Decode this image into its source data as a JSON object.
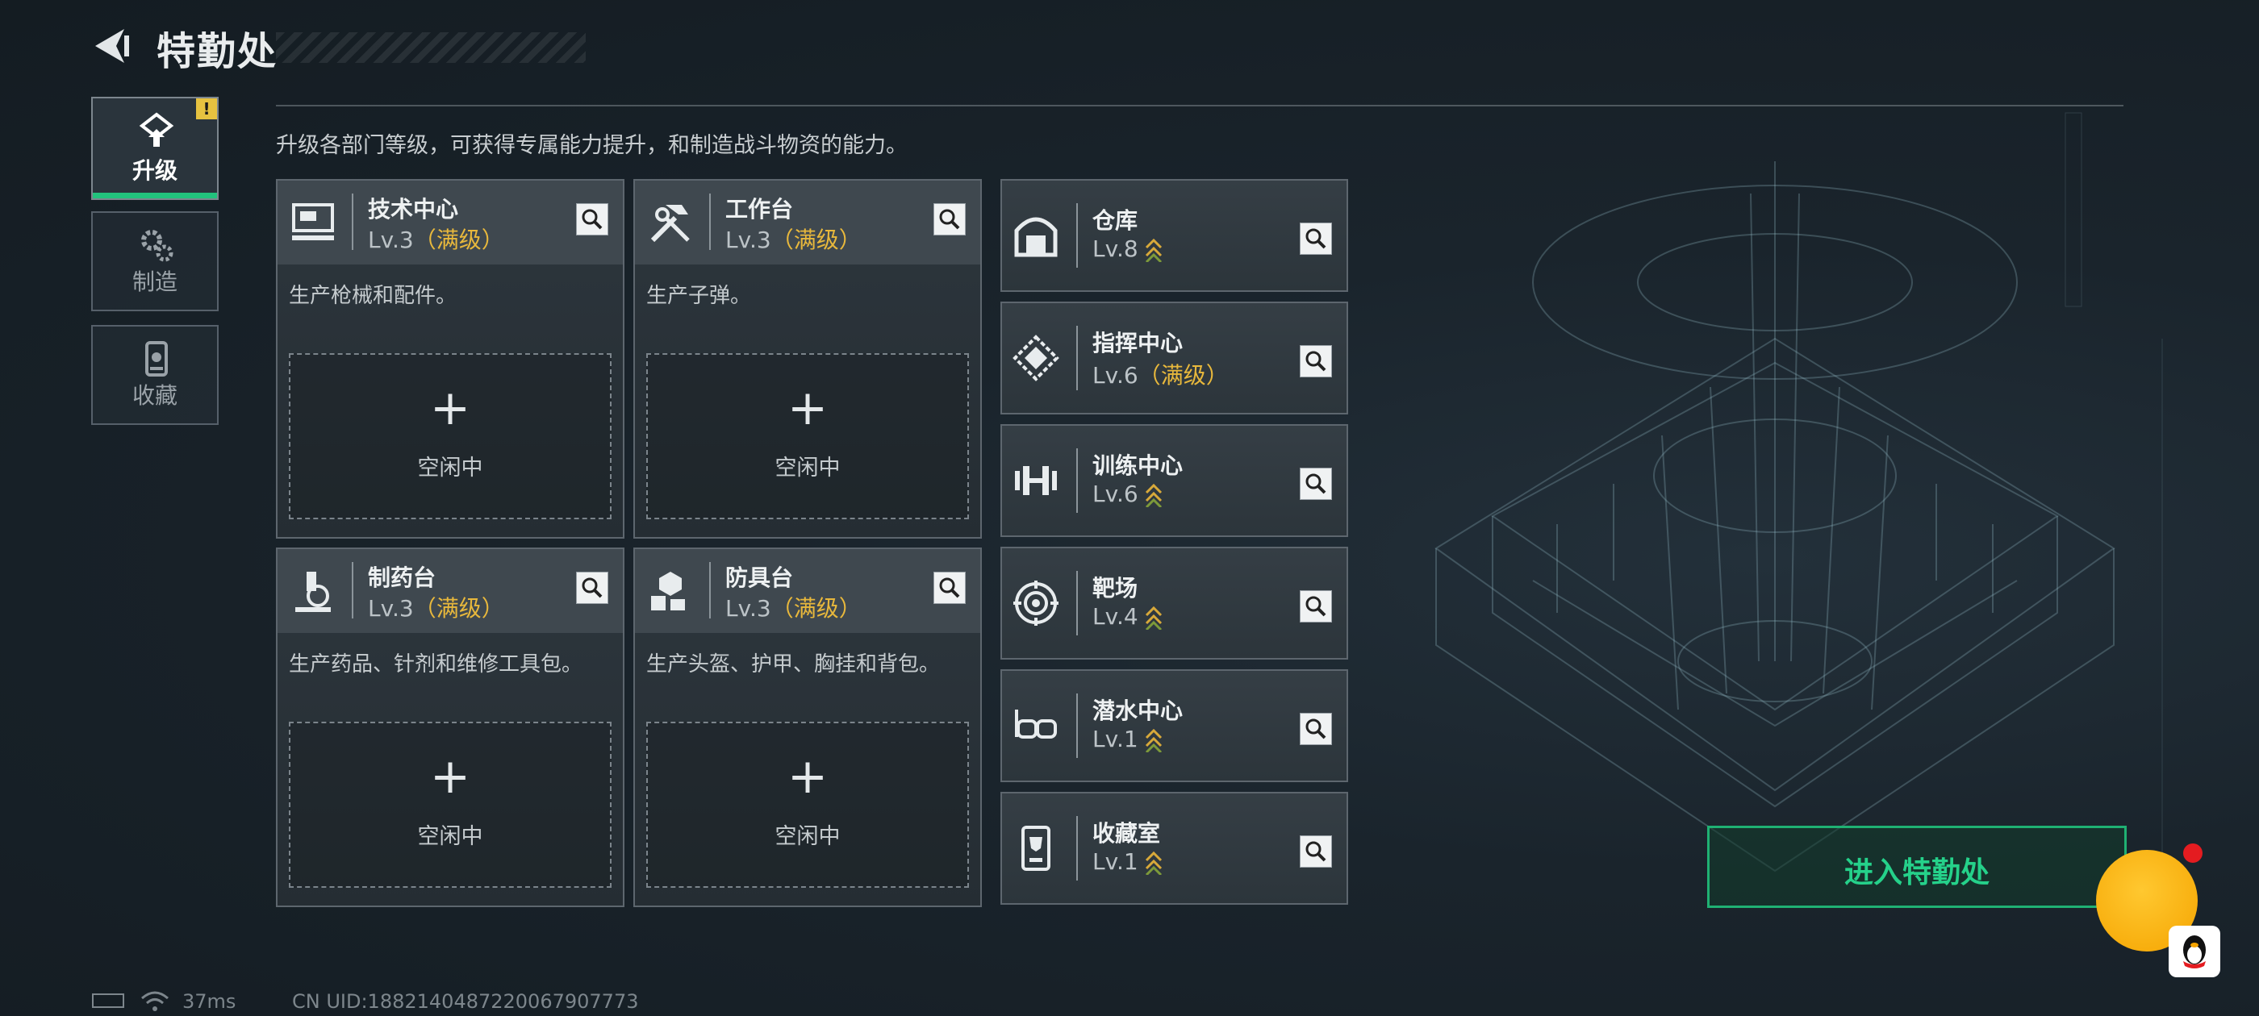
{
  "header": {
    "title": "特勤处",
    "back_icon": "back-arrow-icon"
  },
  "sidebar": {
    "items": [
      {
        "label": "升级",
        "icon": "upgrade-icon",
        "active": true,
        "alert": "!"
      },
      {
        "label": "制造",
        "icon": "gears-icon",
        "active": false
      },
      {
        "label": "收藏",
        "icon": "collection-icon",
        "active": false
      }
    ]
  },
  "description": "升级各部门等级，可获得专属能力提升，和制造战斗物资的能力。",
  "workshops": [
    {
      "name": "技术中心",
      "level": "Lv.3",
      "status": "（满级）",
      "desc": "生产枪械和配件。",
      "plus": "+",
      "idle": "空闲中",
      "icon": "computer-icon"
    },
    {
      "name": "工作台",
      "level": "Lv.3",
      "status": "（满级）",
      "desc": "生产子弹。",
      "plus": "+",
      "idle": "空闲中",
      "icon": "tools-icon"
    },
    {
      "name": "制药台",
      "level": "Lv.3",
      "status": "（满级）",
      "desc": "生产药品、针剂和维修工具包。",
      "plus": "+",
      "idle": "空闲中",
      "icon": "microscope-icon"
    },
    {
      "name": "防具台",
      "level": "Lv.3",
      "status": "（满级）",
      "desc": "生产头盔、护甲、胸挂和背包。",
      "plus": "+",
      "idle": "空闲中",
      "icon": "armor-icon"
    }
  ],
  "facilities": [
    {
      "name": "仓库",
      "level": "Lv.8",
      "status": "",
      "icon": "warehouse-icon"
    },
    {
      "name": "指挥中心",
      "level": "Lv.6",
      "status": "（满级）",
      "icon": "command-icon"
    },
    {
      "name": "训练中心",
      "level": "Lv.6",
      "status": "",
      "icon": "dumbbell-icon"
    },
    {
      "name": "靶场",
      "level": "Lv.4",
      "status": "",
      "icon": "target-icon"
    },
    {
      "name": "潜水中心",
      "level": "Lv.1",
      "status": "",
      "icon": "diving-mask-icon"
    },
    {
      "name": "收藏室",
      "level": "Lv.1",
      "status": "",
      "icon": "trophy-icon"
    }
  ],
  "enter_button": "进入特勤处",
  "footer": {
    "ping": "37ms",
    "uid": "CN UID:1882140487220067907773"
  },
  "colors": {
    "accent": "#22c37d",
    "max_level": "#e8b83c",
    "alert": "#e6c240",
    "orb": "#ffc830"
  }
}
